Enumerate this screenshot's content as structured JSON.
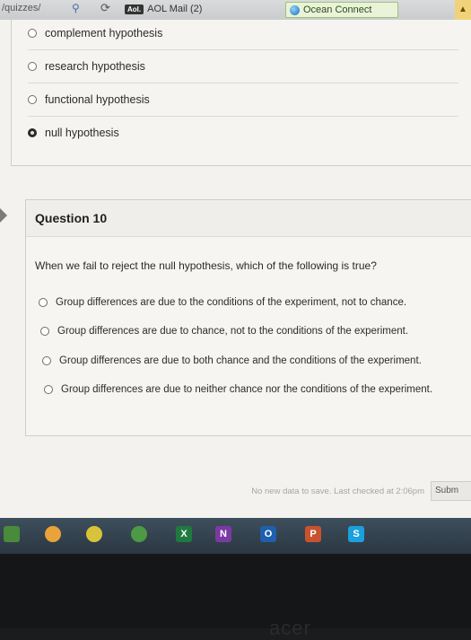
{
  "browser": {
    "url_fragment": "/quizzes/",
    "tab_aol_badge": "Aol.",
    "tab_aol_label": "AOL Mail (2)",
    "tab_ocean_label": "Ocean Connect"
  },
  "previous_question": {
    "options": [
      {
        "label": "complement hypothesis",
        "selected": false
      },
      {
        "label": "research hypothesis",
        "selected": false
      },
      {
        "label": "functional hypothesis",
        "selected": false
      },
      {
        "label": "null hypothesis",
        "selected": true
      }
    ]
  },
  "question": {
    "title": "Question 10",
    "prompt": "When we fail to reject the null hypothesis, which of the following is true?",
    "options": [
      "Group differences are due to the conditions of the experiment, not to chance.",
      "Group differences are due to chance, not to the conditions of the experiment.",
      "Group differences are due to both chance and the conditions of the experiment.",
      "Group differences are due to neither chance nor the conditions of the experiment."
    ]
  },
  "footer": {
    "status": "No new data to save. Last checked at 2:06pm",
    "submit_label": "Subm"
  },
  "taskbar": {
    "excel_label": "X",
    "onenote_label": "N",
    "outlook_label": "O",
    "powerpoint_label": "P",
    "skype_label": "S"
  },
  "bezel": {
    "brand": "acer"
  }
}
